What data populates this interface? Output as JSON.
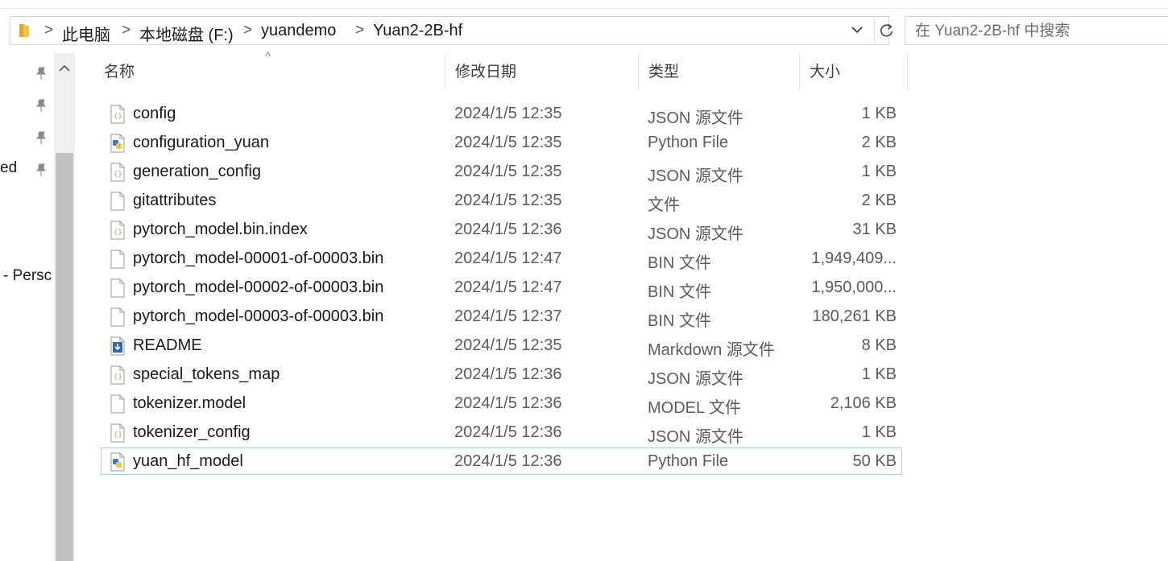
{
  "address": {
    "crumbs": [
      "此电脑",
      "本地磁盘 (F:)",
      "yuandemo",
      "Yuan2-2B-hf"
    ],
    "separator": ">"
  },
  "search": {
    "placeholder": "在 Yuan2-2B-hf 中搜索"
  },
  "nav": {
    "fragments": [
      "ed",
      "- Persc"
    ]
  },
  "columns": {
    "name": "名称",
    "date": "修改日期",
    "type": "类型",
    "size": "大小"
  },
  "sort": {
    "column": "name",
    "indicator": "^"
  },
  "files": [
    {
      "name": "config",
      "date": "2024/1/5 12:35",
      "type": "JSON 源文件",
      "size": "1 KB",
      "icon": "json-file-icon"
    },
    {
      "name": "configuration_yuan",
      "date": "2024/1/5 12:35",
      "type": "Python File",
      "size": "2 KB",
      "icon": "python-file-icon"
    },
    {
      "name": "generation_config",
      "date": "2024/1/5 12:35",
      "type": "JSON 源文件",
      "size": "1 KB",
      "icon": "json-file-icon"
    },
    {
      "name": "gitattributes",
      "date": "2024/1/5 12:35",
      "type": "文件",
      "size": "2 KB",
      "icon": "blank-file-icon"
    },
    {
      "name": "pytorch_model.bin.index",
      "date": "2024/1/5 12:36",
      "type": "JSON 源文件",
      "size": "31 KB",
      "icon": "json-file-icon"
    },
    {
      "name": "pytorch_model-00001-of-00003.bin",
      "date": "2024/1/5 12:47",
      "type": "BIN 文件",
      "size": "1,949,409...",
      "icon": "blank-file-icon"
    },
    {
      "name": "pytorch_model-00002-of-00003.bin",
      "date": "2024/1/5 12:47",
      "type": "BIN 文件",
      "size": "1,950,000...",
      "icon": "blank-file-icon"
    },
    {
      "name": "pytorch_model-00003-of-00003.bin",
      "date": "2024/1/5 12:37",
      "type": "BIN 文件",
      "size": "180,261 KB",
      "icon": "blank-file-icon"
    },
    {
      "name": "README",
      "date": "2024/1/5 12:35",
      "type": "Markdown 源文件",
      "size": "8 KB",
      "icon": "markdown-file-icon"
    },
    {
      "name": "special_tokens_map",
      "date": "2024/1/5 12:36",
      "type": "JSON 源文件",
      "size": "1 KB",
      "icon": "json-file-icon"
    },
    {
      "name": "tokenizer.model",
      "date": "2024/1/5 12:36",
      "type": "MODEL 文件",
      "size": "2,106 KB",
      "icon": "blank-file-icon"
    },
    {
      "name": "tokenizer_config",
      "date": "2024/1/5 12:36",
      "type": "JSON 源文件",
      "size": "1 KB",
      "icon": "json-file-icon"
    },
    {
      "name": "yuan_hf_model",
      "date": "2024/1/5 12:36",
      "type": "Python File",
      "size": "50 KB",
      "icon": "python-file-icon",
      "selected": true
    }
  ],
  "colors": {
    "selection_border": "#99d1ff",
    "folder_yellow": "#f0c44c",
    "python_blue": "#3b78c3",
    "python_yellow": "#f5c542",
    "json_accent": "#b9a84a"
  }
}
